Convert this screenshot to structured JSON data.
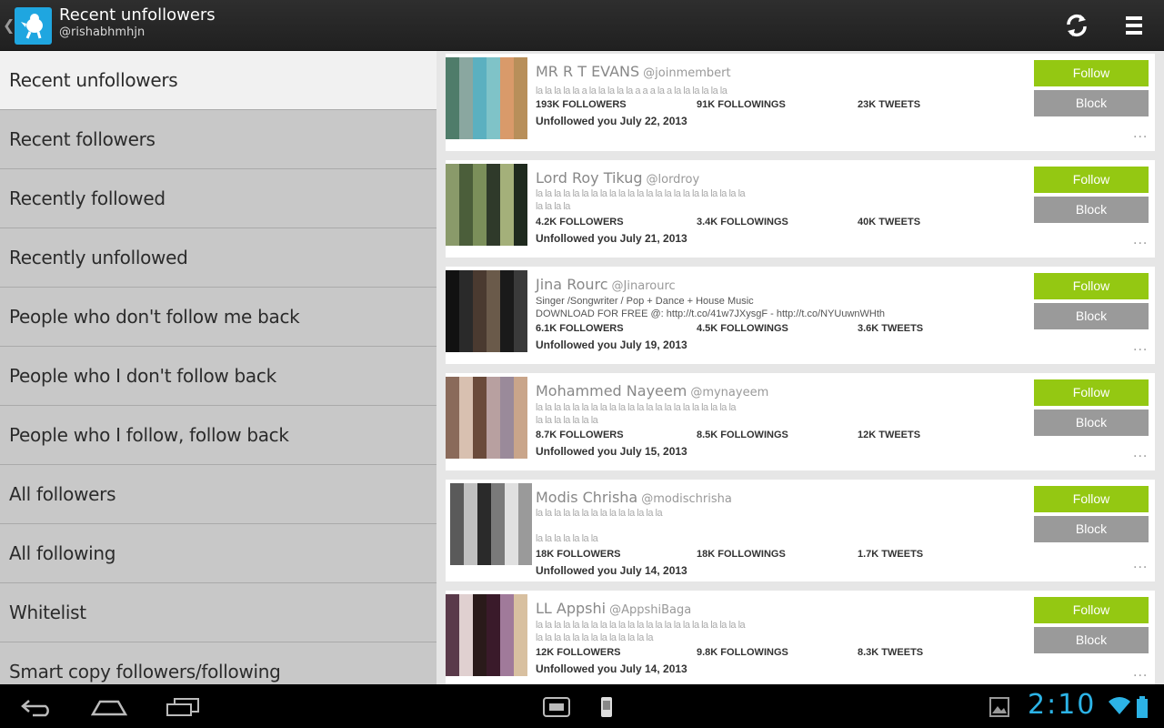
{
  "app": {
    "title": "Recent unfollowers",
    "username": "@rishabhmhjn"
  },
  "sidebar": {
    "items": [
      {
        "label": "Recent unfollowers",
        "active": true
      },
      {
        "label": "Recent followers"
      },
      {
        "label": "Recently followed"
      },
      {
        "label": "Recently unfollowed"
      },
      {
        "label": "People who don't follow me back"
      },
      {
        "label": "People who I don't follow back"
      },
      {
        "label": "People who I follow, follow back"
      },
      {
        "label": "All followers"
      },
      {
        "label": "All following"
      },
      {
        "label": "Whitelist"
      },
      {
        "label": "Smart copy followers/following"
      }
    ]
  },
  "buttons": {
    "follow_label": "Follow",
    "block_label": "Block",
    "more_label": "..."
  },
  "users": [
    {
      "name": "MR R T EVANS",
      "handle": "@joinmembert",
      "bio": [
        "la la la la la a la la la la la a a a la a la la la la la la"
      ],
      "bio_blurred": true,
      "followers": "193K FOLLOWERS",
      "followings": "91K FOLLOWINGS",
      "tweets": "23K TWEETS",
      "unfollowed": "Unfollowed you July 22, 2013"
    },
    {
      "name": "Lord Roy Tikug",
      "handle": "@lordroy",
      "bio": [
        "la la la la la la la la la la la la la la la la la la la la la la la",
        "la la la la"
      ],
      "bio_blurred": true,
      "followers": "4.2K FOLLOWERS",
      "followings": "3.4K FOLLOWINGS",
      "tweets": "40K TWEETS",
      "unfollowed": "Unfollowed you July 21, 2013"
    },
    {
      "name": "Jina Rourc",
      "handle": "@Jinarourc",
      "bio": [
        "Singer /Songwriter / Pop + Dance + House Music",
        "DOWNLOAD FOR FREE @: http://t.co/41w7JXysgF - http://t.co/NYUuwnWHth"
      ],
      "bio_blurred": false,
      "followers": "6.1K FOLLOWERS",
      "followings": "4.5K FOLLOWINGS",
      "tweets": "3.6K TWEETS",
      "unfollowed": "Unfollowed you July 19, 2013"
    },
    {
      "name": "Mohammed Nayeem",
      "handle": "@mynayeem",
      "bio": [
        "la la la la la la la la la la la la la la la la la la la la la la",
        "la la la la la la la"
      ],
      "bio_blurred": true,
      "followers": "8.7K FOLLOWERS",
      "followings": "8.5K FOLLOWINGS",
      "tweets": "12K TWEETS",
      "unfollowed": "Unfollowed you July 15, 2013"
    },
    {
      "name": "Modis Chrisha",
      "handle": "@modischrisha",
      "bio": [
        "la la la la la la la la la la la la la la",
        "",
        "la la la la la la la"
      ],
      "bio_blurred": true,
      "followers": "18K FOLLOWERS",
      "followings": "18K FOLLOWINGS",
      "tweets": "1.7K TWEETS",
      "unfollowed": "Unfollowed you July 14, 2013"
    },
    {
      "name": "LL Appshi",
      "handle": "@AppshiBaga",
      "bio": [
        "la la la la la la la la la la la la la la la la la la la la la la la",
        "la la la la la la la la la la la la la"
      ],
      "bio_blurred": true,
      "followers": "12K FOLLOWERS",
      "followings": "9.8K FOLLOWINGS",
      "tweets": "8.3K TWEETS",
      "unfollowed": "Unfollowed you July 14, 2013"
    }
  ],
  "status_bar": {
    "time": "2:10"
  },
  "colors": {
    "accent": "#94c812",
    "block": "#9a9a9a",
    "clock": "#2cb3e6",
    "actionbar": "#262626"
  }
}
